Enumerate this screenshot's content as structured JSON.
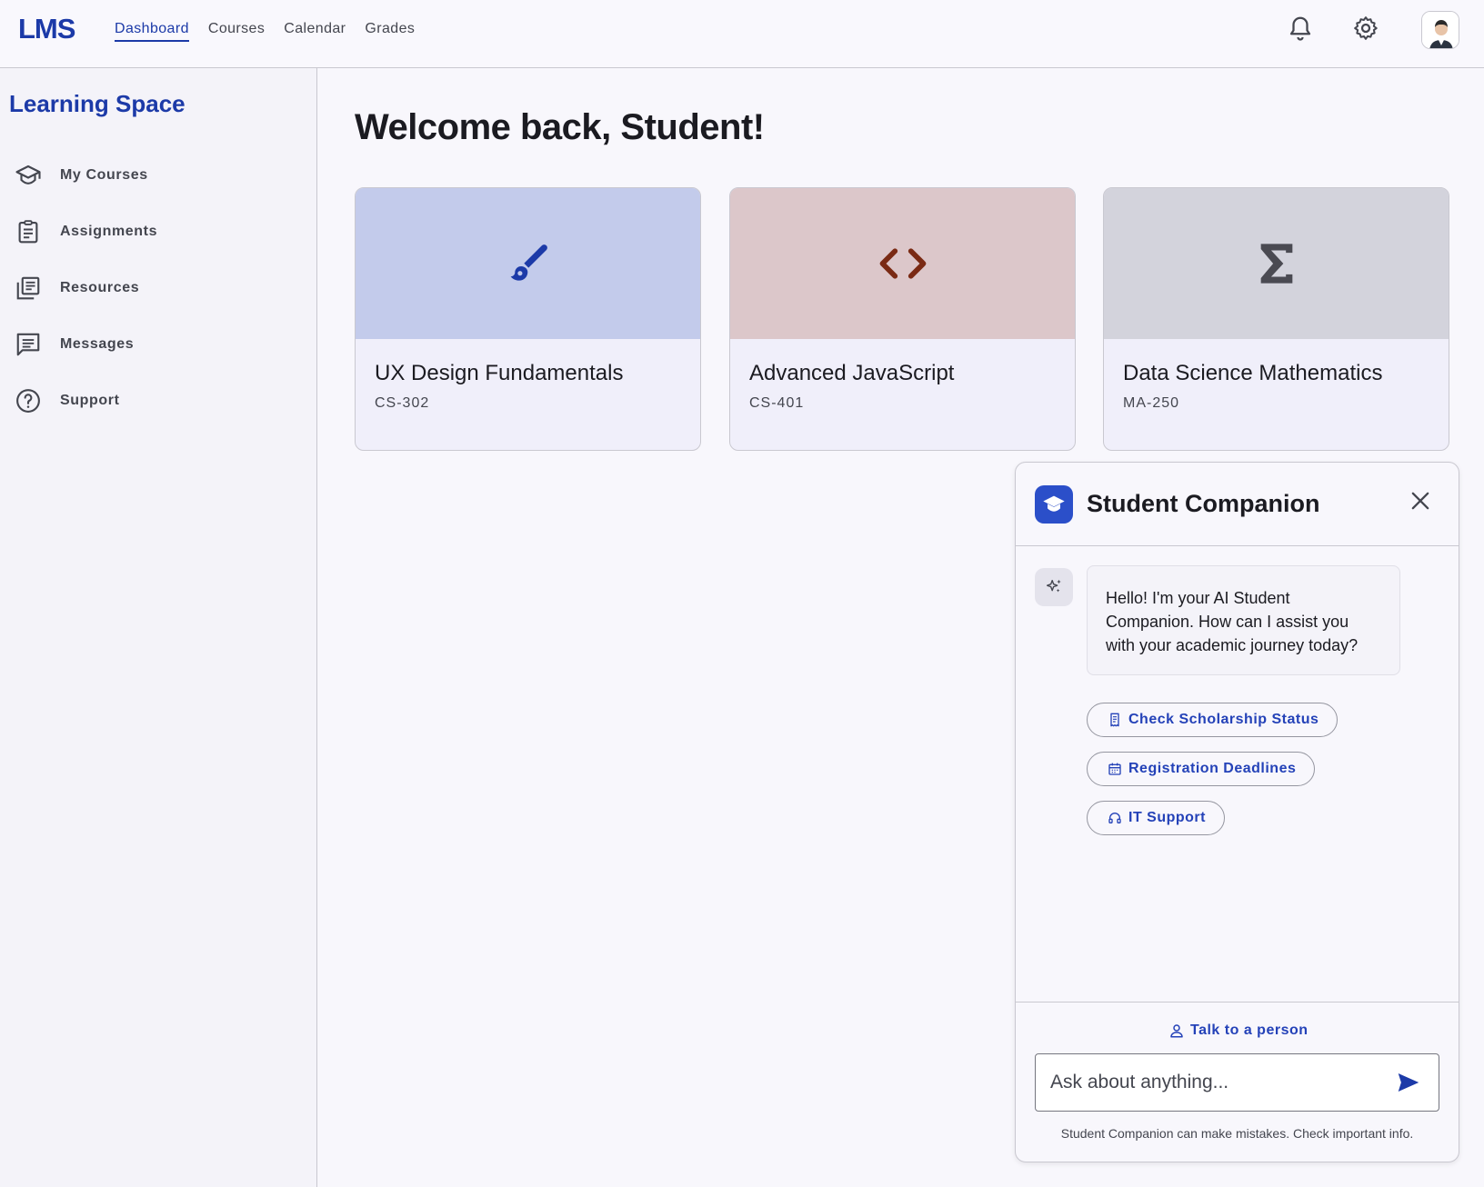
{
  "app": {
    "logo": "LMS"
  },
  "nav": {
    "items": [
      {
        "label": "Dashboard",
        "active": true
      },
      {
        "label": "Courses"
      },
      {
        "label": "Calendar"
      },
      {
        "label": "Grades"
      }
    ]
  },
  "topbar_icons": [
    "bell-icon",
    "gear-icon",
    "avatar"
  ],
  "sidebar": {
    "title": "Learning Space",
    "items": [
      {
        "label": "My Courses",
        "icon": "school-icon"
      },
      {
        "label": "Assignments",
        "icon": "assignment-icon"
      },
      {
        "label": "Resources",
        "icon": "library-icon"
      },
      {
        "label": "Messages",
        "icon": "message-icon"
      },
      {
        "label": "Support",
        "icon": "help-icon"
      }
    ]
  },
  "main": {
    "welcome": "Welcome back, Student!",
    "courses": [
      {
        "title": "UX Design Fundamentals",
        "code": "CS-302",
        "icon": "brush-icon",
        "banner_color": "#c3cbeb",
        "icon_color": "#1c3aa8"
      },
      {
        "title": "Advanced JavaScript",
        "code": "CS-401",
        "icon": "code-icon",
        "banner_color": "#dcc7ca",
        "icon_color": "#7a2a14"
      },
      {
        "title": "Data Science Mathematics",
        "code": "MA-250",
        "icon": "sigma-icon",
        "banner_color": "#d3d3dc",
        "icon_color": "#4a4a52"
      }
    ]
  },
  "chat": {
    "title": "Student Companion",
    "greeting": "Hello! I'm your AI Student Companion. How can I assist you with your academic journey today?",
    "chips": [
      {
        "label": "Check Scholarship Status",
        "icon": "receipt-icon"
      },
      {
        "label": "Registration Deadlines",
        "icon": "calendar-icon"
      },
      {
        "label": "IT Support",
        "icon": "headset-icon"
      }
    ],
    "talk_person": "Talk to a person",
    "input_placeholder": "Ask about anything...",
    "disclaimer": "Student Companion can make mistakes. Check important info."
  },
  "colors": {
    "accent": "#1c3aa8",
    "chat_logo_bg": "#2b4fc9"
  }
}
